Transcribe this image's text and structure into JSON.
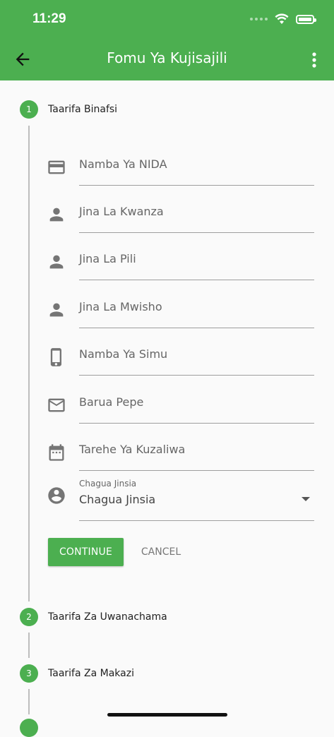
{
  "status_bar": {
    "time": "11:29"
  },
  "app_bar": {
    "title": "Fomu Ya Kujisajili"
  },
  "steps": [
    {
      "number": "1",
      "title": "Taarifa Binafsi"
    },
    {
      "number": "2",
      "title": "Taarifa Za Uwanachama"
    },
    {
      "number": "3",
      "title": "Taarifa Za Makazi"
    }
  ],
  "fields": [
    {
      "icon": "card-icon",
      "label": "Namba Ya NIDA"
    },
    {
      "icon": "person-icon",
      "label": "Jina La Kwanza"
    },
    {
      "icon": "person-icon",
      "label": "Jina La Pili"
    },
    {
      "icon": "person-icon",
      "label": "Jina La Mwisho"
    },
    {
      "icon": "phone-icon",
      "label": "Namba Ya Simu"
    },
    {
      "icon": "mail-icon",
      "label": "Barua Pepe"
    },
    {
      "icon": "calendar-icon",
      "label": "Tarehe Ya Kuzaliwa"
    }
  ],
  "gender_select": {
    "label": "Chagua Jinsia",
    "value": "Chagua Jinsia"
  },
  "actions": {
    "continue": "CONTINUE",
    "cancel": "CANCEL"
  },
  "colors": {
    "primary": "#4caf50",
    "background": "#fafafa"
  }
}
